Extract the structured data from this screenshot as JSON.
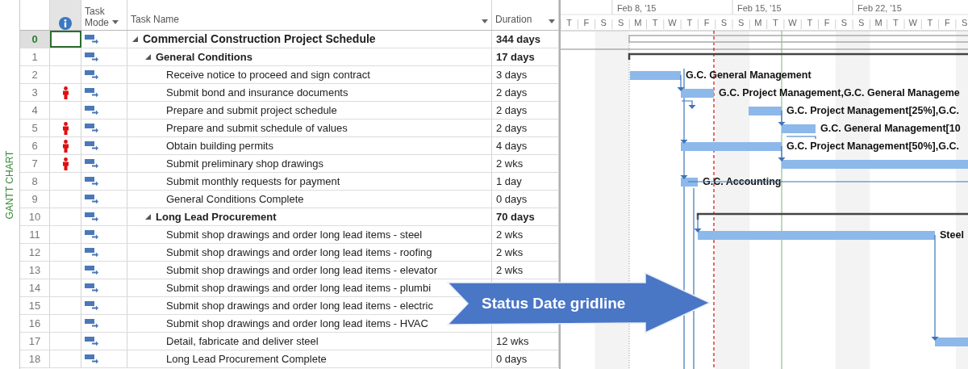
{
  "side_label": "GANTT CHART",
  "columns": [
    {
      "kind": "id"
    },
    {
      "kind": "info"
    },
    {
      "kind": "mode",
      "label": "Task Mode"
    },
    {
      "kind": "name",
      "label": "Task Name"
    },
    {
      "kind": "duration",
      "label": "Duration"
    }
  ],
  "timescale": {
    "weeks": [
      "Feb 8, '15",
      "Feb 15, '15",
      "Feb 22, '15"
    ],
    "days": [
      "T",
      "F",
      "S",
      "S",
      "M",
      "T",
      "W",
      "T",
      "F",
      "S",
      "S",
      "M",
      "T",
      "W",
      "T",
      "F",
      "S",
      "S",
      "M",
      "T",
      "W",
      "T",
      "F",
      "S"
    ]
  },
  "tasks": [
    {
      "id": "0",
      "name": "Commercial Construction Project Schedule",
      "duration": "344 days",
      "summary": true,
      "expanded": true,
      "selected": true,
      "resource_indicator": false,
      "children": [
        {
          "id": "1",
          "name": "General Conditions",
          "duration": "17 days",
          "summary": true,
          "expanded": true,
          "selected": false,
          "resource_indicator": false,
          "children": [
            {
              "id": "2",
              "name": "Receive notice to proceed and sign contract",
              "duration": "3 days",
              "summary": false,
              "selected": false,
              "resource_indicator": false,
              "bar_label": "G.C. General Management"
            },
            {
              "id": "3",
              "name": "Submit bond and insurance documents",
              "duration": "2 days",
              "summary": false,
              "selected": false,
              "resource_indicator": true,
              "bar_label": "G.C. Project Management,G.C. General Manageme"
            },
            {
              "id": "4",
              "name": "Prepare and submit project schedule",
              "duration": "2 days",
              "summary": false,
              "selected": false,
              "resource_indicator": false,
              "bar_label": "G.C. Project Management[25%],G.C."
            },
            {
              "id": "5",
              "name": "Prepare and submit schedule of values",
              "duration": "2 days",
              "summary": false,
              "selected": false,
              "resource_indicator": true,
              "bar_label": "G.C. General Management[10"
            },
            {
              "id": "6",
              "name": "Obtain building permits",
              "duration": "4 days",
              "summary": false,
              "selected": false,
              "resource_indicator": true,
              "bar_label": "G.C. Project Management[50%],G.C."
            },
            {
              "id": "7",
              "name": "Submit preliminary shop drawings",
              "duration": "2 wks",
              "summary": false,
              "selected": false,
              "resource_indicator": true
            },
            {
              "id": "8",
              "name": "Submit monthly requests for payment",
              "duration": "1 day",
              "summary": false,
              "selected": false,
              "resource_indicator": false,
              "bar_label": "G.C. Accounting"
            },
            {
              "id": "9",
              "name": "General Conditions Complete",
              "duration": "0 days",
              "summary": false,
              "selected": false,
              "resource_indicator": false
            }
          ]
        },
        {
          "id": "10",
          "name": "Long Lead Procurement",
          "duration": "70 days",
          "summary": true,
          "expanded": true,
          "selected": false,
          "resource_indicator": false,
          "children": [
            {
              "id": "11",
              "name": "Submit shop drawings and order long lead items - steel",
              "duration": "2 wks",
              "summary": false,
              "selected": false,
              "resource_indicator": false,
              "bar_label": "Steel"
            },
            {
              "id": "12",
              "name": "Submit shop drawings and order long lead items - roofing",
              "duration": "2 wks",
              "summary": false,
              "selected": false,
              "resource_indicator": false
            },
            {
              "id": "13",
              "name": "Submit shop drawings and order long lead items - elevator",
              "duration": "2 wks",
              "summary": false,
              "selected": false,
              "resource_indicator": false
            },
            {
              "id": "14",
              "name": "Submit shop drawings and order long lead items - plumbi",
              "summary": false,
              "selected": false,
              "resource_indicator": false
            },
            {
              "id": "15",
              "name": "Submit shop drawings and order long lead items - electric",
              "summary": false,
              "selected": false,
              "resource_indicator": false
            },
            {
              "id": "16",
              "name": "Submit shop drawings and order long lead items - HVAC",
              "summary": false,
              "selected": false,
              "resource_indicator": false
            },
            {
              "id": "17",
              "name": "Detail, fabricate and deliver steel",
              "duration": "12 wks",
              "summary": false,
              "selected": false,
              "resource_indicator": false
            },
            {
              "id": "18",
              "name": "Long Lead Procurement Complete",
              "duration": "0 days",
              "summary": false,
              "selected": false,
              "resource_indicator": false
            }
          ]
        }
      ]
    }
  ],
  "callout": {
    "text": "Status Date gridline"
  }
}
